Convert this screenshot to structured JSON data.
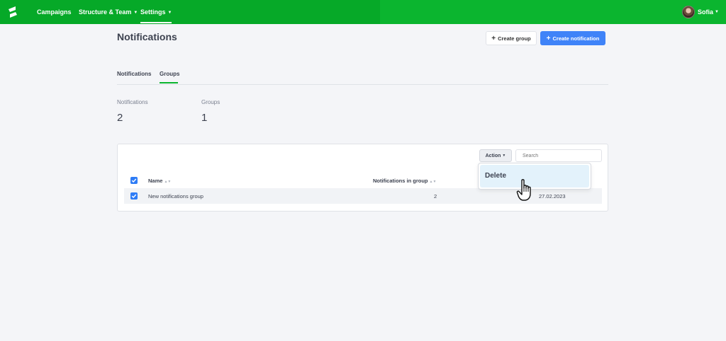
{
  "nav": {
    "items": [
      {
        "label": "Campaigns"
      },
      {
        "label": "Structure & Team"
      },
      {
        "label": "Settings"
      }
    ],
    "user": {
      "name": "Sofia"
    }
  },
  "header": {
    "title": "Notifications",
    "create_group_label": "Create group",
    "create_notification_label": "Create notification"
  },
  "tabs": [
    {
      "label": "Notifications"
    },
    {
      "label": "Groups",
      "active": true
    }
  ],
  "stats": [
    {
      "label": "Notifications",
      "value": "2"
    },
    {
      "label": "Groups",
      "value": "1"
    }
  ],
  "toolbar": {
    "action_label": "Action",
    "search_placeholder": "Search"
  },
  "table": {
    "columns": [
      "Name",
      "Notifications in group"
    ],
    "rows": [
      {
        "name": "New notifications group",
        "count": "2",
        "date": "27.02.2023",
        "checked": true
      }
    ]
  },
  "dropdown": {
    "items": [
      {
        "label": "Delete"
      }
    ]
  },
  "colors": {
    "brand_green": "#0bb52f",
    "primary_blue": "#3f83f8",
    "checkbox_blue": "#2e7cf6",
    "dropdown_highlight": "#e3f2fb"
  },
  "icons": [
    "logo-icon",
    "chevron-down-icon",
    "plus-icon",
    "sort-icon",
    "checkbox-checked-icon",
    "hand-pointer-icon"
  ]
}
